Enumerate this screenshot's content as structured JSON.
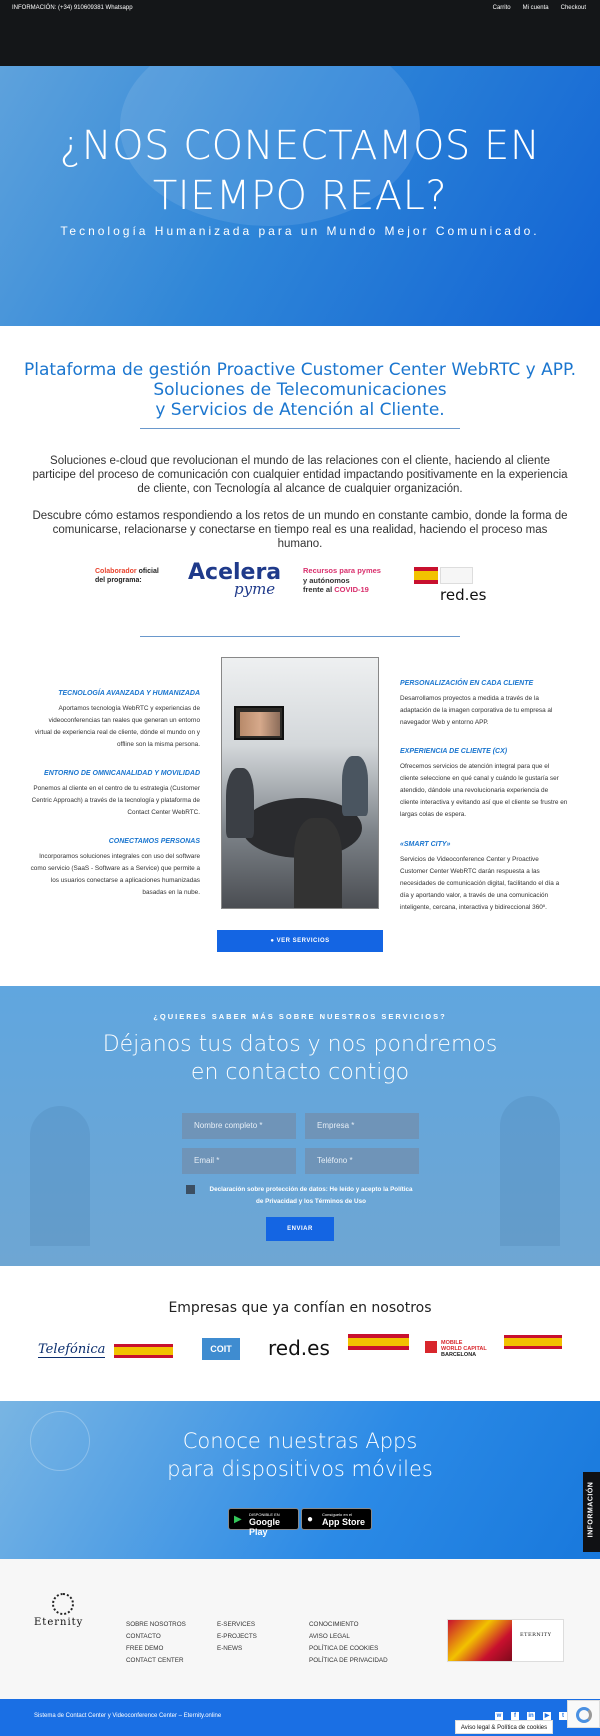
{
  "topbar": {
    "info": "INFORMACIÓN: (+34) 910609381 Whatsapp",
    "links": [
      "Carrito",
      "Mi cuenta",
      "Checkout"
    ]
  },
  "hero": {
    "title_line1": "¿NOS CONECTAMOS EN",
    "title_line2": "TIEMPO REAL?",
    "subtitle": "Tecnología Humanizada para un Mundo Mejor Comunicado."
  },
  "platform": {
    "heading_line1": "Plataforma de gestión Proactive Customer Center WebRTC y APP.",
    "heading_line2": "Soluciones de Telecomunicaciones",
    "heading_line3": "y Servicios de Atención al Cliente.",
    "paragraph1": "Soluciones e-cloud  que revolucionan el mundo de las relaciones con el cliente, haciendo al cliente participe del proceso de comunicación con cualquier entidad impactando positivamente en la experiencia de cliente, con Tecnología al alcance de cualquier organización.",
    "paragraph2": "Descubre cómo estamos respondiendo a los retos de un mundo en constante cambio, donde la forma de comunicarse, relacionarse y conectarse en tiempo real es una realidad, haciendo el proceso mas humano."
  },
  "program_logos": {
    "colaborador_line1a": "Colaborador",
    "colaborador_line1b": "oficial",
    "colaborador_line2": "del programa:",
    "acelera": "Acelera",
    "pyme": "pyme",
    "recursos_line1": "Recursos para pymes",
    "recursos_line2": "y autónomos",
    "recursos_line3a": "frente al ",
    "recursos_line3b": "COVID-19",
    "redes": "red.es"
  },
  "services": {
    "left": [
      {
        "title": "TECNOLOGÍA AVANZADA Y HUMANIZADA",
        "text": "Aportamos tecnología WebRTC y experiencias de videoconferencias tan reales que generan un entorno virtual de experiencia real de cliente, dónde el mundo on y offline son la misma persona."
      },
      {
        "title": "ENTORNO DE OMNICANALIDAD Y MOVILIDAD",
        "text": "Ponemos al cliente en el centro de tu estrategia (Customer Centric Approach) a través de la tecnología y plataforma de Contact Center WebRTC."
      },
      {
        "title": "CONECTAMOS PERSONAS",
        "text": "Incorporamos soluciones integrales con uso del software como servicio (SaaS - Software as a Service) que permite a los usuarios conectarse a aplicaciones humanizadas basadas en la nube."
      }
    ],
    "right": [
      {
        "title": "PERSONALIZACIÓN EN CADA CLIENTE",
        "text": "Desarrollamos proyectos a medida a través de la adaptación de la imagen corporativa de tu empresa al navegador Web y entorno APP."
      },
      {
        "title": "EXPERIENCIA DE CLIENTE (CX)",
        "text": "Ofrecemos servicios de atención integral para que el cliente seleccione en qué canal y cuándo le gustaría ser atendido, dándole una revolucionaria experiencia de cliente interactiva y evitando así que el cliente se frustre en largas colas de espera."
      },
      {
        "title": "«SMART CITY»",
        "text": "Servicios de Videoconference Center y Proactive Customer Center WebRTC darán respuesta a las necesidades de comunicación digital, facilitando el día a día y aportando valor, a través de una comunicación inteligente, cercana, interactiva y bidireccional 360º."
      }
    ],
    "button": "VER SERVICIOS"
  },
  "contact": {
    "kicker": "¿QUIERES SABER MÁS SOBRE NUESTROS SERVICIOS?",
    "heading_line1": "Déjanos tus datos y nos pondremos",
    "heading_line2": "en contacto contigo",
    "name_placeholder": "Nombre completo *",
    "company_placeholder": "Empresa *",
    "email_placeholder": "Email *",
    "phone_placeholder": "Teléfono *",
    "consent_line1": "Declaración sobre protección de datos: He leído y acepto la Política",
    "consent_line2": "de Privacidad y los Términos de Uso",
    "submit": "ENVIAR"
  },
  "brands": {
    "heading": "Empresas que ya confían en nosotros",
    "telefonica": "Telefónica",
    "coit": "COIT",
    "redes": "red.es",
    "mwc_line1": "MOBILE",
    "mwc_line2": "WORLD CAPITAL",
    "mwc_line3": "BARCELONA"
  },
  "apps": {
    "heading_line1": "Conoce nuestras Apps",
    "heading_line2": "para dispositivos móviles",
    "google_small": "DISPONIBLE EN",
    "google_big": "Google Play",
    "apple_small": "Consíguelo en el",
    "apple_big": "App Store"
  },
  "info_tab": "INFORMACIÓN",
  "footer": {
    "logo_text": "Eternity",
    "col1": [
      "SOBRE NOSOTROS",
      "CONTACTO",
      "FREE DEMO",
      "CONTACT CENTER"
    ],
    "col2": [
      "E-SERVICES",
      "E-PROJECTS",
      "E-NEWS"
    ],
    "col3": [
      "CONOCIMIENTO",
      "AVISO LEGAL",
      "POLÍTICA DE COOKIES",
      "POLÍTICA DE PRIVACIDAD"
    ],
    "badge_brand": "ETERNITY"
  },
  "bottom": {
    "text": "Sistema de Contact Center y Videoconference Center – Eternity.online",
    "cookie": "Aviso legal & Política de cookies"
  },
  "colors": {
    "accent": "#1b76cf",
    "button": "#1465e3",
    "topbar": "#141618"
  }
}
